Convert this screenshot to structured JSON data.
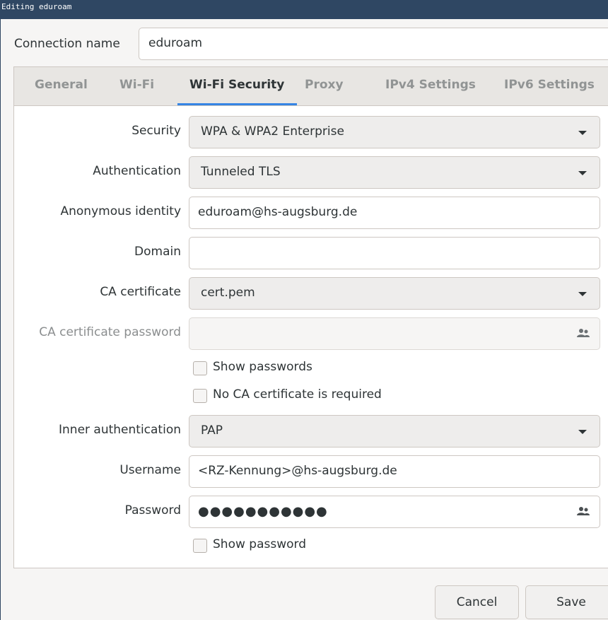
{
  "window": {
    "title": "Editing eduroam"
  },
  "connection": {
    "label": "Connection name",
    "value": "eduroam"
  },
  "tabs": [
    {
      "label": "General"
    },
    {
      "label": "Wi-Fi"
    },
    {
      "label": "Wi-Fi Security",
      "active": true
    },
    {
      "label": "Proxy"
    },
    {
      "label": "IPv4 Settings"
    },
    {
      "label": "IPv6 Settings"
    }
  ],
  "form": {
    "security": {
      "label": "Security",
      "value": "WPA & WPA2 Enterprise"
    },
    "authentication": {
      "label": "Authentication",
      "value": "Tunneled TLS"
    },
    "anonymous_identity": {
      "label": "Anonymous identity",
      "value": "eduroam@hs-augsburg.de"
    },
    "domain": {
      "label": "Domain",
      "value": ""
    },
    "ca_certificate": {
      "label": "CA certificate",
      "value": "cert.pem"
    },
    "ca_certificate_password": {
      "label": "CA certificate password",
      "value": ""
    },
    "show_passwords": {
      "label": "Show passwords",
      "checked": false
    },
    "no_ca_required": {
      "label": "No CA certificate is required",
      "checked": false
    },
    "inner_authentication": {
      "label": "Inner authentication",
      "value": "PAP"
    },
    "username": {
      "label": "Username",
      "value": "<RZ-Kennung>@hs-augsburg.de"
    },
    "password": {
      "label": "Password",
      "value": "●●●●●●●●●●●"
    },
    "show_password": {
      "label": "Show password",
      "checked": false
    }
  },
  "buttons": {
    "cancel": "Cancel",
    "save": "Save"
  },
  "colors": {
    "titlebar": "#2f4763",
    "accent": "#3584e4"
  },
  "icons": {
    "password_store": "people-icon",
    "dropdown": "chevron-down-icon"
  }
}
